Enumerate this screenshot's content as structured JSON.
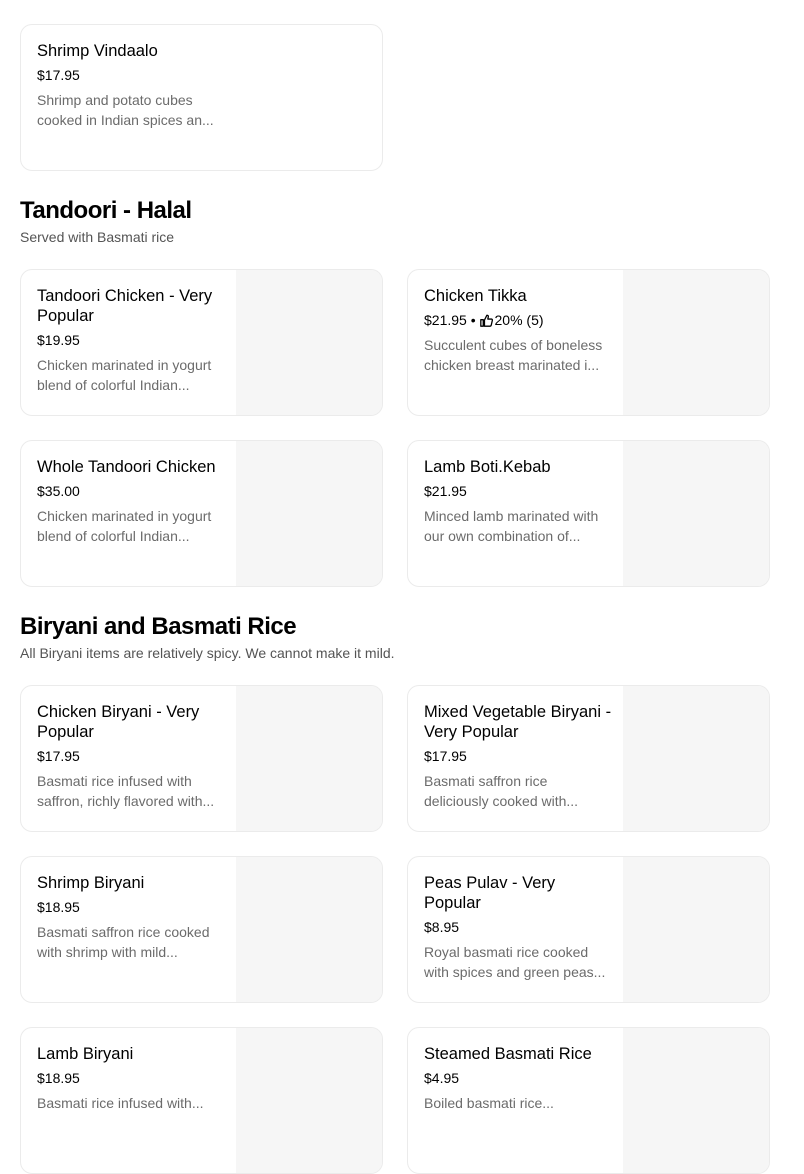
{
  "sections": [
    {
      "title": "",
      "subtitle": "",
      "items": [
        {
          "name": "Shrimp Vindaalo",
          "price": "$17.95",
          "desc": "Shrimp and potato cubes cooked in Indian spices an..."
        }
      ]
    },
    {
      "title": "Tandoori - Halal",
      "subtitle": "Served with Basmati rice",
      "items": [
        {
          "name": "Tandoori Chicken - Very Popular",
          "price": "$19.95",
          "desc": "Chicken marinated in yogurt blend of colorful Indian..."
        },
        {
          "name": "Chicken Tikka",
          "price": "$21.95",
          "rating_sep": " • ",
          "rating": "20% (5)",
          "rating_icon": "thumbs-up-icon",
          "desc": "Succulent cubes of boneless chicken breast marinated i..."
        },
        {
          "name": "Whole Tandoori Chicken",
          "price": "$35.00",
          "desc": "Chicken marinated in yogurt blend of colorful Indian..."
        },
        {
          "name": "Lamb Boti.Kebab",
          "price": "$21.95",
          "desc": "Minced lamb marinated with our own combination of..."
        }
      ]
    },
    {
      "title": "Biryani and Basmati Rice",
      "subtitle": "All Biryani items are relatively spicy. We cannot make it mild.",
      "items": [
        {
          "name": "Chicken Biryani - Very Popular",
          "price": "$17.95",
          "desc": "Basmati rice infused with saffron, richly flavored with..."
        },
        {
          "name": "Mixed Vegetable Biryani - Very Popular",
          "price": "$17.95",
          "desc": "Basmati saffron rice deliciously cooked with..."
        },
        {
          "name": "Shrimp Biryani",
          "price": "$18.95",
          "desc": "Basmati saffron rice cooked with shrimp with mild..."
        },
        {
          "name": "Peas Pulav - Very Popular",
          "price": "$8.95",
          "desc": "Royal basmati rice cooked with spices and green peas..."
        },
        {
          "name": "Lamb Biryani",
          "price": "$18.95",
          "desc": "Basmati rice infused with..."
        },
        {
          "name": "Steamed Basmati Rice",
          "price": "$4.95",
          "desc": "Boiled basmati rice..."
        }
      ]
    }
  ],
  "colors": {
    "card_border": "#ebebeb",
    "image_placeholder": "#f6f6f6",
    "secondary_text": "#6b6b6b"
  }
}
